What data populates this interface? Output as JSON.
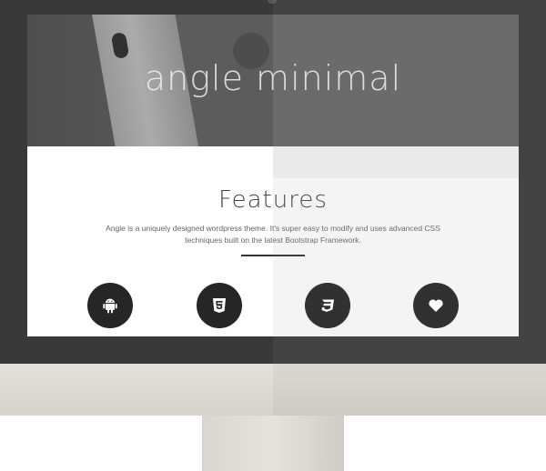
{
  "hero": {
    "title": "angle minimal"
  },
  "features": {
    "title": "Features",
    "description": "Angle is a uniquely designed wordpress theme. It's super easy to modify and uses advanced CSS techniques built on the latest Bootstrap Framework.",
    "icons": [
      {
        "name": "android-icon"
      },
      {
        "name": "html5-icon"
      },
      {
        "name": "css3-icon"
      },
      {
        "name": "heart-icon"
      }
    ]
  },
  "colors": {
    "frame": "#3a383b",
    "icon_circle": "#262626",
    "bezel": "#dedcd5"
  }
}
